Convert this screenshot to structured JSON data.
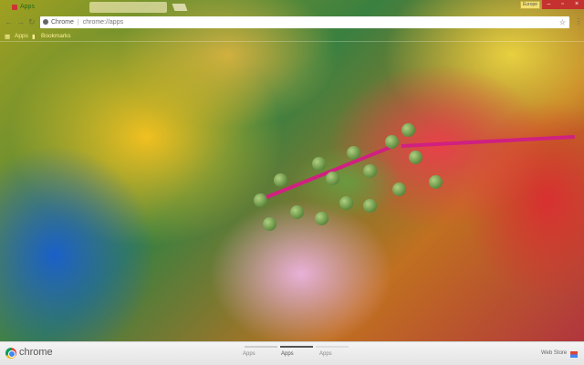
{
  "tab": {
    "title": "Apps"
  },
  "window": {
    "user": "Europe",
    "minimize": "–",
    "maximize": "▫",
    "close": "×"
  },
  "toolbar": {
    "back": "←",
    "forward": "→",
    "reload": "↻",
    "site_label": "Chrome",
    "url": "chrome://apps",
    "star": "☆",
    "menu": "⋮"
  },
  "bookmarks": {
    "apps": "Apps",
    "bookmarks": "Bookmarks"
  },
  "bottom": {
    "brand": "chrome",
    "pages": [
      "Apps",
      "Apps",
      "Apps"
    ],
    "active_page": 1,
    "webstore": "Web Store"
  }
}
